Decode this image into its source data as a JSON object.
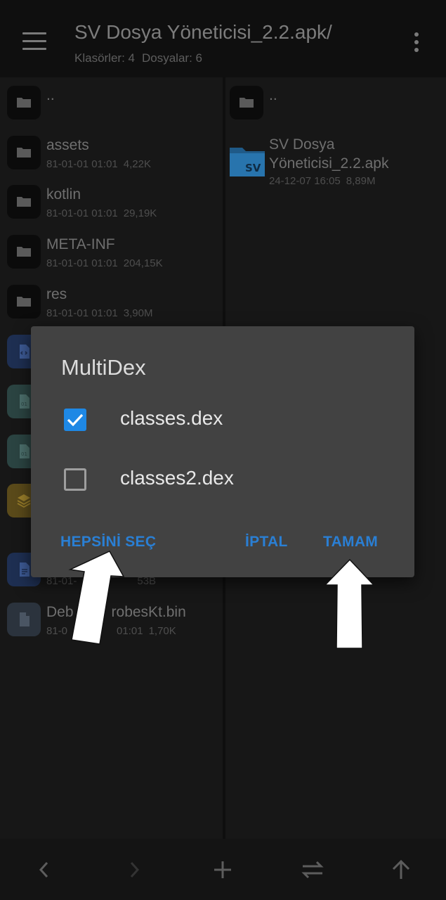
{
  "colors": {
    "accent": "#1e88e5",
    "dialog_button": "#2a7fd4",
    "dialog_background": "#424242"
  },
  "app_bar": {
    "title": "SV Dosya Yöneticisi_2.2.apk/",
    "folders_text": "Klasörler: 4",
    "files_text": "Dosyalar: 6",
    "menu_icon": "hamburger-menu-icon",
    "more_icon": "more-vertical-icon"
  },
  "left_pane": {
    "parent_row": {
      "name": "..",
      "icon": "folder-icon"
    },
    "folders": [
      {
        "name": "assets",
        "date": "81-01-01 01:01",
        "size": "4,22K",
        "icon": "folder-icon"
      },
      {
        "name": "kotlin",
        "date": "81-01-01 01:01",
        "size": "29,19K",
        "icon": "folder-icon"
      },
      {
        "name": "META-INF",
        "date": "81-01-01 01:01",
        "size": "204,15K",
        "icon": "folder-icon"
      },
      {
        "name": "res",
        "date": "81-01-01 01:01",
        "size": "3,90M",
        "icon": "folder-icon"
      }
    ],
    "partially_hidden_rows": [
      {
        "meta": "81-01-",
        "size": "53B",
        "icon": "document-icon"
      }
    ],
    "last_file": {
      "name_start": "Deb",
      "name_end": "robesKt.bin",
      "date": "81-0",
      "time": "01:01",
      "size": "1,70K",
      "icon": "document-icon"
    }
  },
  "right_pane": {
    "parent_row": {
      "name": "..",
      "icon": "folder-icon"
    },
    "apk": {
      "name_line1": "SV Dosya",
      "name_line2": "Yöneticisi_2.2.apk",
      "date": "24-12-07 16:05",
      "size": "8,89M",
      "badge": "SV",
      "icon": "apk-folder-icon"
    }
  },
  "bottom_bar": {
    "buttons": [
      {
        "icon": "chevron-left-icon"
      },
      {
        "icon": "chevron-right-icon"
      },
      {
        "icon": "plus-icon"
      },
      {
        "icon": "swap-icon"
      },
      {
        "icon": "arrow-up-icon"
      }
    ]
  },
  "dialog": {
    "title": "MultiDex",
    "options": [
      {
        "label": "classes.dex",
        "checked": true
      },
      {
        "label": "classes2.dex",
        "checked": false
      }
    ],
    "select_all_label": "HEPSİNİ SEÇ",
    "cancel_label": "İPTAL",
    "ok_label": "TAMAM"
  }
}
